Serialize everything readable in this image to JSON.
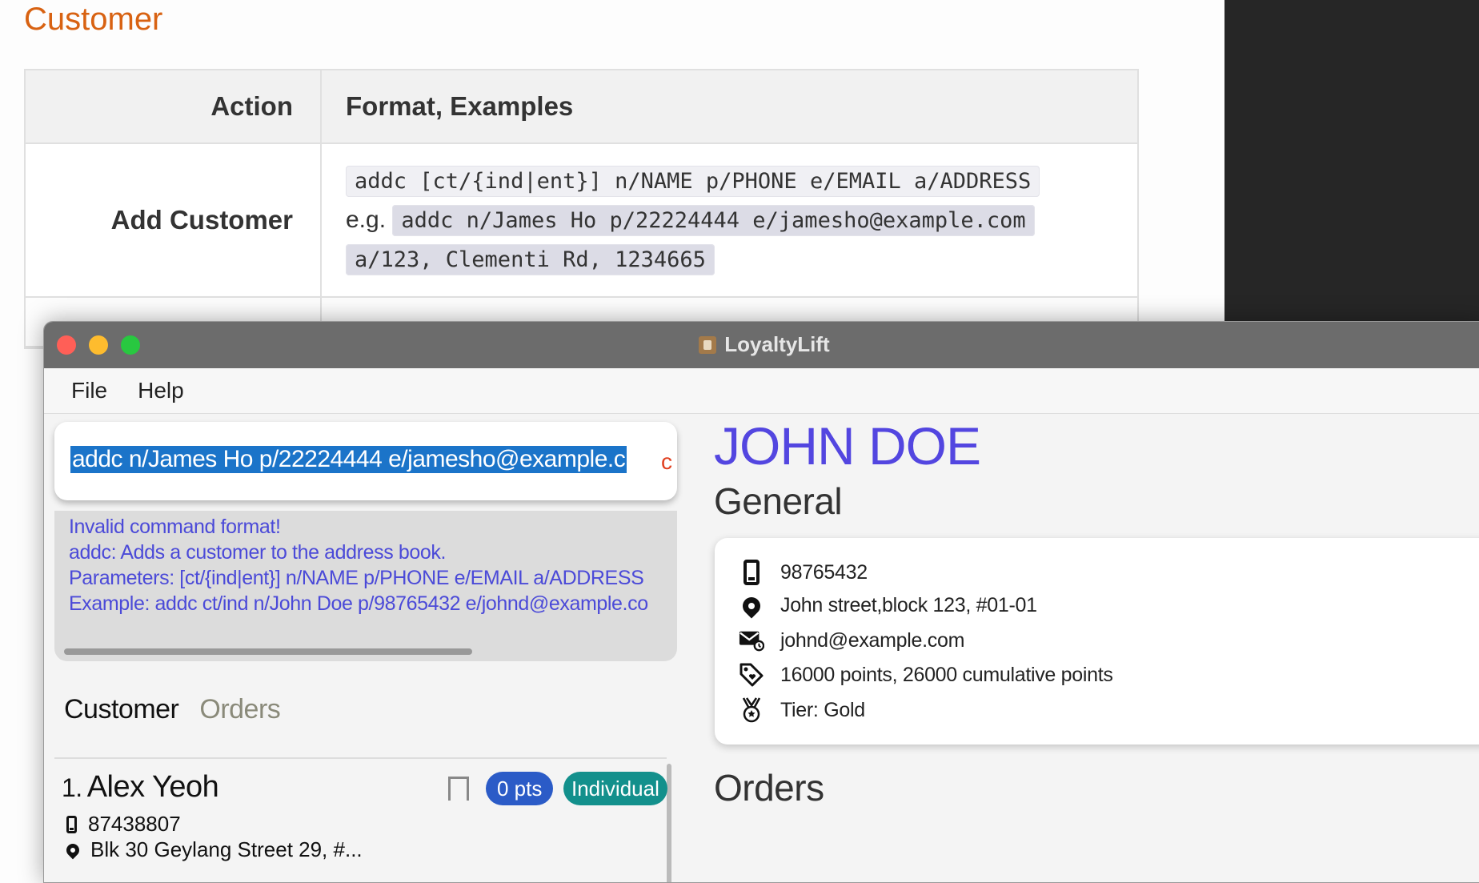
{
  "doc": {
    "section_title": "Customer",
    "table": {
      "headers": [
        "Action",
        "Format, Examples"
      ],
      "rows": [
        {
          "action": "Add Customer",
          "format": "addc [ct/{ind|ent}] n/NAME p/PHONE e/EMAIL a/ADDRESS",
          "example_prefix": "e.g.",
          "example_line1": "addc n/James Ho p/22224444 e/jamesho@example.com",
          "example_line2": "a/123, Clementi Rd, 1234665"
        }
      ]
    }
  },
  "window": {
    "title": "LoyaltyLift",
    "menu": [
      "File",
      "Help"
    ]
  },
  "command": {
    "value": "addc n/James Ho p/22224444 e/jamesho@example.c",
    "overflow_char": "c"
  },
  "result": {
    "lines": [
      "Invalid command format!",
      "addc: Adds a customer to the address book.",
      "Parameters: [ct/{ind|ent}] n/NAME p/PHONE e/EMAIL a/ADDRESS",
      "Example: addc ct/ind n/John Doe p/98765432 e/johnd@example.co"
    ]
  },
  "tabs": [
    "Customer",
    "Orders"
  ],
  "customers": [
    {
      "index": "1.",
      "name": "Alex Yeoh",
      "phone": "87438807",
      "address": "Blk 30 Geylang Street 29, #...",
      "points_badge": "0 pts",
      "type_badge": "Individual",
      "bookmark_icon": "bookmark-icon"
    }
  ],
  "detail": {
    "name": "JOHN DOE",
    "general_heading": "General",
    "phone": "98765432",
    "address": "John street,block 123, #01-01",
    "email": "johnd@example.com",
    "points": "16000 points, 26000 cumulative points",
    "tier": "Tier: Gold",
    "orders_heading": "Orders"
  },
  "colors": {
    "doc_title": "#d86212",
    "accent_name": "#5346e0",
    "result_text": "#4b4ad8",
    "selection": "#1b74c9",
    "points_badge": "#2b5bc7",
    "type_badge": "#13908c"
  }
}
